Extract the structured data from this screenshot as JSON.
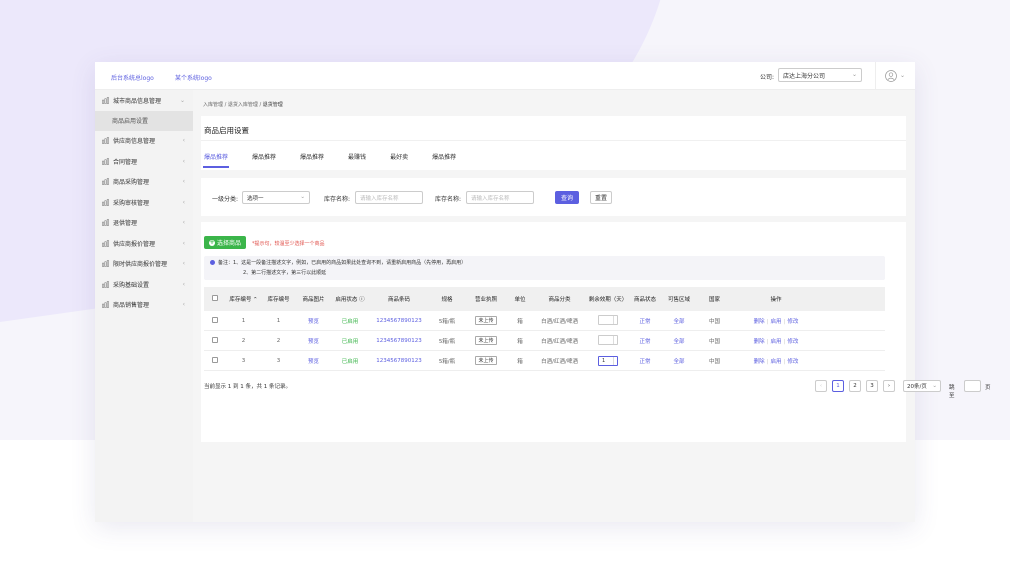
{
  "header": {
    "logo_left": "后台系统总logo",
    "logo_right": "某个系统logo",
    "company_label": "公司:",
    "company_value": "店达上海分公司"
  },
  "sidebar": {
    "items": [
      {
        "label": "城市商品信息管理",
        "expanded": true
      },
      {
        "label": "供应商信息管理"
      },
      {
        "label": "合同管理"
      },
      {
        "label": "商品采购管理"
      },
      {
        "label": "采购审核管理"
      },
      {
        "label": "退供管理"
      },
      {
        "label": "供应商报价管理"
      },
      {
        "label": "限时供应商报价管理"
      },
      {
        "label": "采购基础设置"
      },
      {
        "label": "商品销售管理"
      }
    ],
    "sub_item": "商品启用设置"
  },
  "breadcrumb": {
    "parts": [
      "入库管理",
      "退货入库管理",
      "退货管理"
    ],
    "sep": "/"
  },
  "page_title": "商品启用设置",
  "tabs": [
    "爆品推荐",
    "爆品推荐",
    "爆品推荐",
    "最赚钱",
    "最好卖",
    "爆品推荐"
  ],
  "filters": {
    "cat_label": "一级分类:",
    "cat_value": "选项一",
    "name_label_1": "库存名称:",
    "name_placeholder_1": "请输入库存名称",
    "name_label_2": "库存名称:",
    "name_placeholder_2": "请输入库存名称",
    "search": "查询",
    "reset": "重置"
  },
  "actions": {
    "select_product": "选择商品",
    "tip": "*提示句，较温至少选择一个商品",
    "note_line1": "备注：1、这是一段备注描述文字，例如，已启用的商品如果此处查询不到，请重新启用商品（先停用，再启用）",
    "note_line2": "2、第二行描述文字，第三行以此顺延"
  },
  "table": {
    "columns": [
      "库存编号 ⌃",
      "库存编号",
      "商品图片",
      "启用状态 ⓘ",
      "商品条码",
      "规格",
      "营业执照",
      "单位",
      "商品分类",
      "剩余效期（天）",
      "商品状态",
      "可售区域",
      "国家",
      "操作"
    ],
    "rows": [
      {
        "id": "1",
        "no": "1",
        "img": "预览",
        "status": "已启用",
        "barcode": "1234567890123",
        "spec": "5箱/瓶",
        "license": "未上传",
        "unit": "箱",
        "category": "白酒/红酒/啤酒",
        "days": "",
        "state": "正常",
        "region": "全部",
        "country": "中国"
      },
      {
        "id": "2",
        "no": "2",
        "img": "预览",
        "status": "已启用",
        "barcode": "1234567890123",
        "spec": "5箱/瓶",
        "license": "未上传",
        "unit": "箱",
        "category": "白酒/红酒/啤酒",
        "days": "",
        "state": "正常",
        "region": "全部",
        "country": "中国"
      },
      {
        "id": "3",
        "no": "3",
        "img": "预览",
        "status": "已启用",
        "barcode": "1234567890123",
        "spec": "5箱/瓶",
        "license": "未上传",
        "unit": "箱",
        "category": "白酒/红酒/啤酒",
        "days": "1",
        "state": "正常",
        "region": "全部",
        "country": "中国"
      }
    ],
    "op_delete": "删除",
    "op_enable": "启用",
    "op_edit": "修改"
  },
  "footer": {
    "summary": "当前显示 1 到 1 条，共 1 条记录。",
    "prev": "‹",
    "pages": [
      "1",
      "2",
      "3"
    ],
    "next": "›",
    "page_size": "20条/页",
    "jump_label": "跳至",
    "page_unit": "页"
  },
  "colors": {
    "accent": "#5c5fe0",
    "green": "#3bb54a",
    "tip": "#e0504a"
  }
}
